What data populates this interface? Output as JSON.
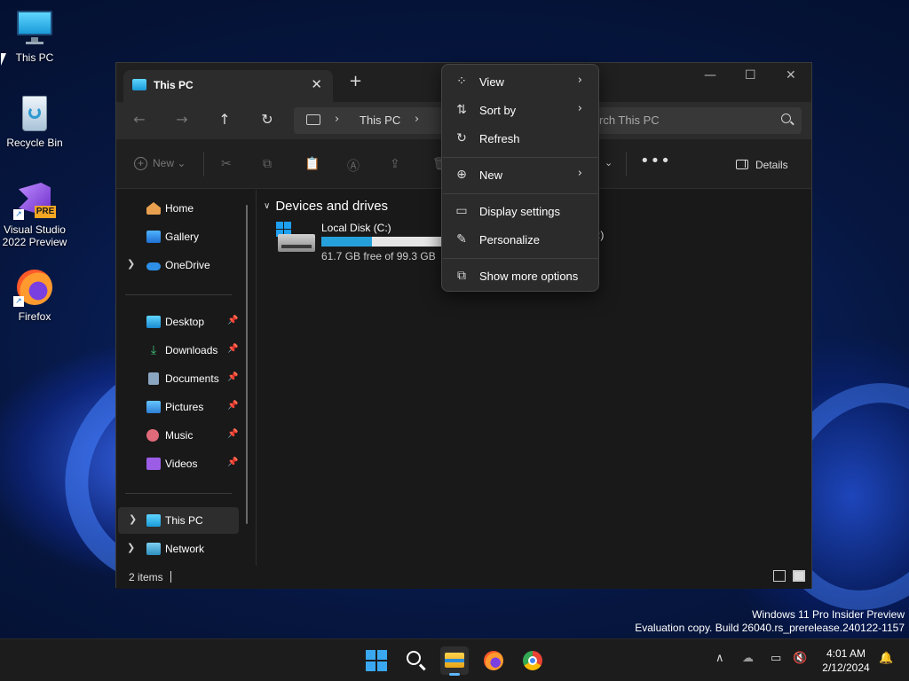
{
  "desktop": {
    "icons": [
      {
        "label": "This PC",
        "icon": "monitor-icon"
      },
      {
        "label": "Recycle Bin",
        "icon": "recycle-bin-icon"
      },
      {
        "label": "Visual Studio\n2022 Preview",
        "icon": "visual-studio-icon",
        "badge": "PRE"
      },
      {
        "label": "Firefox",
        "icon": "firefox-icon"
      }
    ],
    "watermark_line1": "Windows 11 Pro Insider Preview",
    "watermark_line2": "Evaluation copy. Build 26040.rs_prerelease.240122-1157"
  },
  "explorer": {
    "tab_title": "This PC",
    "new_tab": "+",
    "address": {
      "crumb": "This PC"
    },
    "search": {
      "placeholder": "Search This PC",
      "visible_text": "rch This PC"
    },
    "toolbar": {
      "new_label": "New",
      "details_label": "Details",
      "more": "•••"
    },
    "sidebar": {
      "items": [
        {
          "label": "Home",
          "icon": "home-icon"
        },
        {
          "label": "Gallery",
          "icon": "gallery-icon"
        },
        {
          "label": "OneDrive",
          "icon": "onedrive-icon",
          "expandable": true
        }
      ],
      "pinned": [
        {
          "label": "Desktop",
          "icon": "desktop-folder-icon"
        },
        {
          "label": "Downloads",
          "icon": "downloads-icon"
        },
        {
          "label": "Documents",
          "icon": "documents-icon"
        },
        {
          "label": "Pictures",
          "icon": "pictures-icon"
        },
        {
          "label": "Music",
          "icon": "music-icon"
        },
        {
          "label": "Videos",
          "icon": "videos-icon"
        }
      ],
      "bottom": [
        {
          "label": "This PC",
          "icon": "this-pc-icon",
          "selected": true
        },
        {
          "label": "Network",
          "icon": "network-icon"
        }
      ]
    },
    "content": {
      "group_title": "Devices and drives",
      "drives": [
        {
          "name": "Local Disk (C:)",
          "free_text": "61.7 GB free of 99.3 GB",
          "used_fraction": 0.379
        }
      ],
      "second_drive_partial": ":)"
    },
    "status": {
      "items": "2 items"
    }
  },
  "context_menu": {
    "items": [
      {
        "label": "View",
        "icon": "view-grid-icon",
        "submenu": true
      },
      {
        "label": "Sort by",
        "icon": "sort-icon",
        "submenu": true
      },
      {
        "label": "Refresh",
        "icon": "refresh-icon",
        "submenu": false
      },
      {
        "label": "New",
        "icon": "new-plus-icon",
        "submenu": true
      },
      {
        "label": "Display settings",
        "icon": "display-settings-icon",
        "submenu": false
      },
      {
        "label": "Personalize",
        "icon": "personalize-pen-icon",
        "submenu": false
      },
      {
        "label": "Show more options",
        "icon": "show-more-options-icon",
        "submenu": false
      }
    ]
  },
  "taskbar": {
    "apps": [
      "start-icon",
      "search-icon",
      "file-explorer-icon",
      "firefox-icon",
      "chrome-icon"
    ],
    "clock_time": "4:01 AM",
    "clock_date": "2/12/2024"
  },
  "colors": {
    "accent": "#26a0da",
    "window_bg": "#191919",
    "menu_bg": "#2b2b2b"
  }
}
